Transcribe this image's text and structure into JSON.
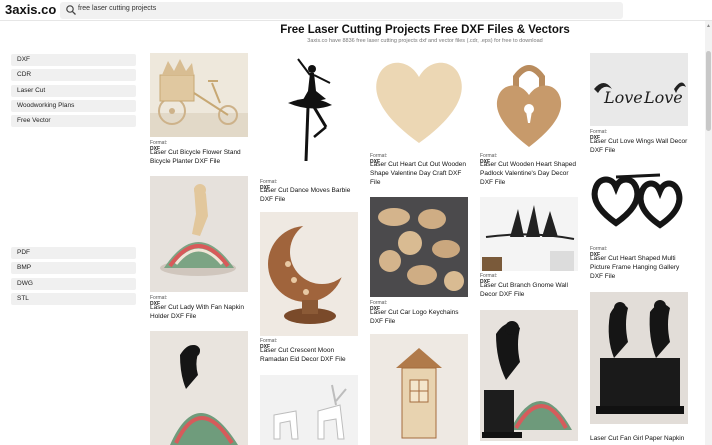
{
  "site": {
    "logo": "3axis.co"
  },
  "search": {
    "value": "free laser cutting projects"
  },
  "page": {
    "title": "Free Laser Cutting Projects Free DXF Files & Vectors",
    "subtitle": "3axis.co have 8836 free laser cutting projects dxf and vector files (.cdr, .eps) for free to download"
  },
  "sidebar": {
    "categories": [
      "DXF",
      "CDR",
      "Laser Cut",
      "Woodworking Plans",
      "Free Vector"
    ],
    "formats": [
      "PDF",
      "BMP",
      "DWG",
      "STL"
    ]
  },
  "format_label": "Format:",
  "cards": [
    {
      "format": "DXF",
      "title": "Laser Cut Bicycle Flower Stand Bicycle Planter DXF File"
    },
    {
      "format": "DXF",
      "title": "Laser Cut Lady With Fan Napkin Holder DXF File"
    },
    {
      "format": "",
      "title": ""
    },
    {
      "format": "DXF",
      "title": "Laser Cut Dance Moves Barbie DXF File"
    },
    {
      "format": "DXF",
      "title": "Laser Cut Crescent Moon Ramadan Eid Decor DXF File"
    },
    {
      "format": "",
      "title": ""
    },
    {
      "format": "DXF",
      "title": "Laser Cut Heart Cut Out Wooden Shape Valentine Day Craft DXF File"
    },
    {
      "format": "DXF",
      "title": "Laser Cut Car Logo Keychains DXF File"
    },
    {
      "format": "",
      "title": ""
    },
    {
      "format": "DXF",
      "title": "Laser Cut Wooden Heart Shaped Padlock Valentine's Day Decor DXF File"
    },
    {
      "format": "DXF",
      "title": "Laser Cut Branch Gnome Wall Decor DXF File"
    },
    {
      "format": "",
      "title": ""
    },
    {
      "format": "DXF",
      "title": "Laser Cut Love Wings Wall Decor DXF File"
    },
    {
      "format": "DXF",
      "title": "Laser Cut Heart Shaped Multi Picture Frame Hanging Gallery DXF File"
    },
    {
      "format": "",
      "title": "Laser Cut Fan Girl Paper Napkin"
    }
  ]
}
